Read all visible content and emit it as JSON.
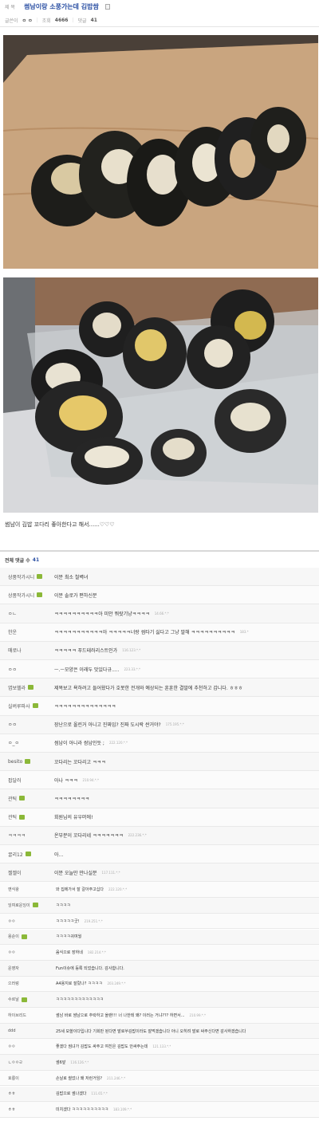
{
  "post": {
    "title_label": "제 목",
    "title": "썸남이랑 소풍가는데 김밥쌈",
    "writer_label": "글쓴이",
    "writer": "ㅇ ㅇ",
    "views_label": "조회",
    "views": "4666",
    "comments_label": "댓글",
    "comments_count": "41",
    "body": "썸남이 김밥 꼬다리 좋아한다고 해서......♡♡♡"
  },
  "comments": {
    "header_label": "전체 댓글 수",
    "count": "41",
    "items": [
      {
        "nick": "상품작가시니",
        "badge": true,
        "text": "이분 최소 철벽녀",
        "date": ""
      },
      {
        "nick": "상품작가시니",
        "badge": true,
        "text": "이분 솔로가 편하신분",
        "date": ""
      },
      {
        "nick": "ㅇㄴ",
        "badge": false,
        "text": "ㅋㅋㅋㅋㅋㅋㅋㅋㅋㅋ아 미안 뭐랏기냥ㅋㅋㅋㅋ",
        "date": "14.66.*.*"
      },
      {
        "nick": "한운",
        "badge": false,
        "text": "ㅋㅋㅋㅋㅋㅋㅋㅋㅋㅋㅋ아 ㅋㅋㅋㅋㅋ너랑 썸타기 싫다고 그냥 말해 ㅋㅋㅋㅋㅋㅋㅋㅋㅋㅋ",
        "date": "183.*"
      },
      {
        "nick": "매로나",
        "badge": false,
        "text": "ㅋㅋㅋㅋㅋ 푸드테러리스트인가",
        "date": "116.123.*.*"
      },
      {
        "nick": "ㅇㅇ",
        "badge": false,
        "text": "ㅡ.ㅡ모양은 이래두 맛있다규.....",
        "date": "223.33.*.*"
      },
      {
        "nick": "엽보헬라",
        "badge": true,
        "text": "제목보고 욕하려고 들어왔다가 호못한 전개와 예상되는 훈훈한 결말에 추천하고 갑니다. ㅎㅎㅎ",
        "date": ""
      },
      {
        "nick": "실버루파사",
        "badge": true,
        "text": "ㅋㅋㅋㅋㅋㅋㅋㅋㅋㅋㅋㅋㅋㅋ",
        "date": ""
      },
      {
        "nick": "ㅇㅇ",
        "badge": false,
        "text": "장난으로 올린거 아니고 진짜임? 진짜 도시락 싼거야?",
        "date": "175.195.*.*"
      },
      {
        "nick": "ㅇ_ㅇ",
        "badge": false,
        "text": "썸남이 아니라 쌈남인듯 ;",
        "date": "222.120.*.*"
      },
      {
        "nick": "besito",
        "badge": true,
        "text": "꼬다리는 꼬다리고 ㅋㅋㅋ",
        "date": ""
      },
      {
        "nick": "팝달러",
        "badge": false,
        "text": "아나 ㅋㅋㅋ",
        "date": "210.94.*.*"
      },
      {
        "nick": "관틱",
        "badge": true,
        "text": "ㅋㅋㅋㅋㅋㅋㅋㅋ",
        "date": ""
      },
      {
        "nick": "관틱",
        "badge": true,
        "text": "회원님의 유우머에!",
        "date": ""
      },
      {
        "nick": "ㅋㅋㅋㅋ",
        "badge": false,
        "text": "온부분이 꼬다리네 ㅋㅋㅋㅋㅋㅋㅋ",
        "date": "222.236.*.*"
      },
      {
        "nick": "꿀리12",
        "badge": true,
        "text": "아...",
        "date": ""
      },
      {
        "nick": "젤젤이",
        "badge": false,
        "text": "이분 오늘만 만나실분",
        "date": "117.111.*.*"
      },
      {
        "nick": "옌식왕",
        "badge": false,
        "text": "와 집에가서 잘 갈아주고십다",
        "date": "222.120.*.*"
      },
      {
        "nick": "잉여로운잉이",
        "badge": true,
        "text": "ㅋㅋㅋㅋ",
        "date": ""
      },
      {
        "nick": "ㅇㅇ",
        "badge": false,
        "text": "ㅋㅋㅋㅋㅋ굿!",
        "date": "219.251.*.*"
      },
      {
        "nick": "용순이",
        "badge": true,
        "text": "ㅋㅋㅋㅋ귀여웡",
        "date": ""
      },
      {
        "nick": "ㅇㅇ",
        "badge": false,
        "text": "음식으로 장하네",
        "date": "182.214.*.*"
      },
      {
        "nick": "운영자",
        "badge": false,
        "text": "Fun이슈에 등록 되었습니다. 감사합니다.",
        "date": ""
      },
      {
        "nick": "으러렁",
        "badge": false,
        "text": "A4용지로 잘랐나? ㅋㅋㅋㅋ",
        "date": "203.249.*.*"
      },
      {
        "nick": "수르날",
        "badge": true,
        "text": "ㅋㅋㅋㅋㅋㅋㅋㅋㅋㅋㅋㅋㅋ",
        "date": ""
      },
      {
        "nick": "하이브리드",
        "badge": false,
        "text": "썸남 바로 썸남으로 추락하고 올랜!!! 너 나한테 왜? 이러는 거냐??? 하면서...",
        "date": "210.99.*.*"
      },
      {
        "nick": "ddd",
        "badge": false,
        "text": "25세 모쏠이다입니다 기회만 된다면 발로쑤김밥이라도 잘먹겠습니다 아니 오히려 발로 싸주신다면 감사하겠습니다",
        "date": ""
      },
      {
        "nick": "ㅇㅇ",
        "badge": false,
        "text": "좋겠다 썸녀가 김밥도 싸주고 여친은 김밥도 안싸주는데",
        "date": "121.133.*.*"
      },
      {
        "nick": "ㄴㅇㅇㄹ",
        "badge": false,
        "text": "썸6앞",
        "date": "116.126.*.*"
      },
      {
        "nick": "호롱이",
        "badge": false,
        "text": "손날로 썰었나 왜 저런거임?",
        "date": "211.246.*.*"
      },
      {
        "nick": "ㅎㅎ",
        "badge": false,
        "text": "김밥으로 썸나겠다",
        "date": "111.65.*.*"
      },
      {
        "nick": "ㅎㅎ",
        "badge": false,
        "text": "미치겠다 ㅋㅋㅋㅋㅋㅋㅋㅋㅋㅋ",
        "date": "183.109.*.*"
      }
    ]
  }
}
